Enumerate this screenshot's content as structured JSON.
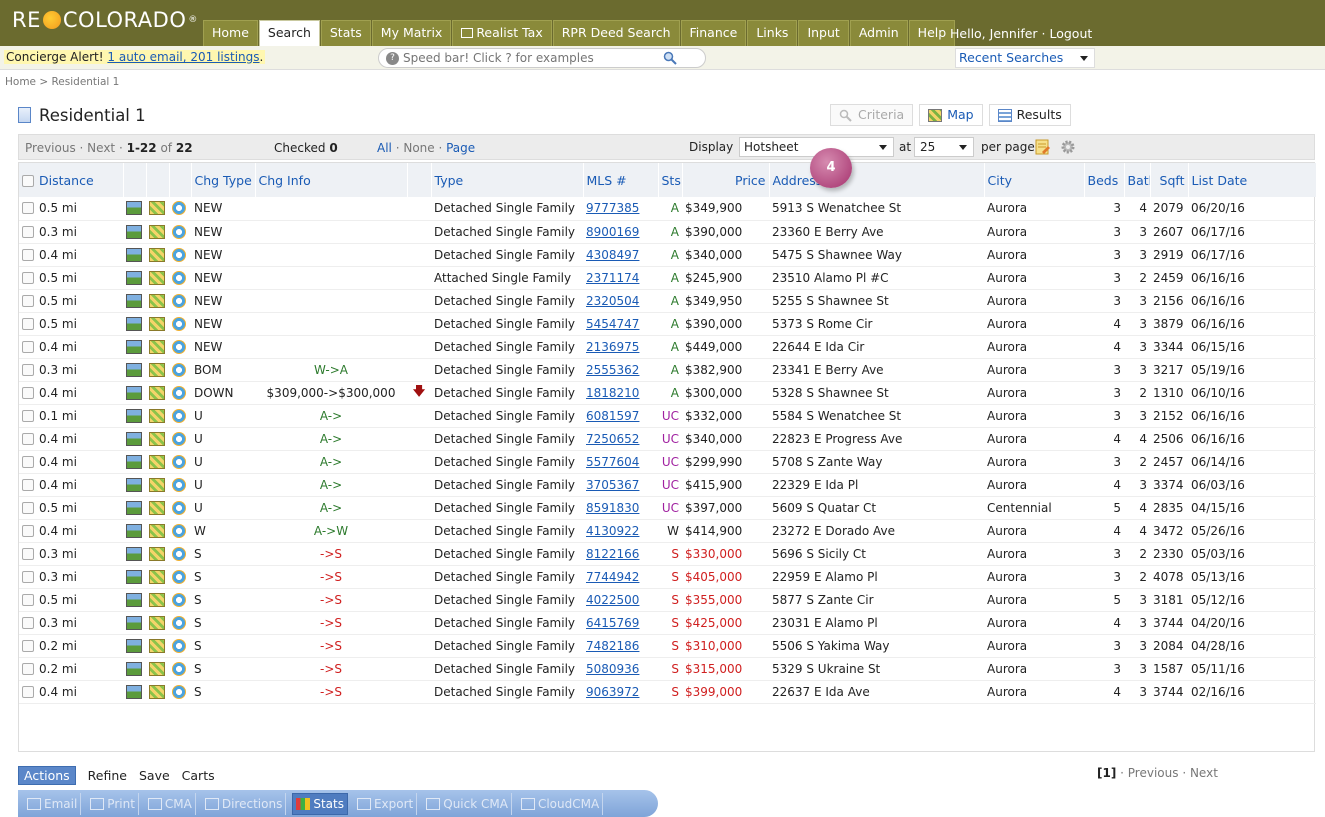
{
  "app": {
    "logo_text_left": "RE",
    "logo_text_right": "COLORADO",
    "logo_reg": "®",
    "greeting": "Hello, Jennifer · Logout"
  },
  "nav": {
    "tabs": [
      {
        "label": "Home",
        "active": false
      },
      {
        "label": "Search",
        "active": true
      },
      {
        "label": "Stats",
        "active": false
      },
      {
        "label": "My Matrix",
        "active": false
      },
      {
        "label": "Realist Tax",
        "active": false,
        "icon": "grid-icon"
      },
      {
        "label": "RPR Deed Search",
        "active": false
      },
      {
        "label": "Finance",
        "active": false
      },
      {
        "label": "Links",
        "active": false
      },
      {
        "label": "Input",
        "active": false
      },
      {
        "label": "Admin",
        "active": false
      },
      {
        "label": "Help",
        "active": false
      }
    ]
  },
  "alert": {
    "prefix": "Concierge Alert!",
    "link_text": "1 auto email, 201 listings",
    "suffix": "."
  },
  "speedbar": {
    "placeholder": "Speed bar! Click ? for examples",
    "help": "?"
  },
  "recent_searches": "Recent Searches",
  "breadcrumb": "Home > Residential 1",
  "page_title": "Residential 1",
  "view_tabs": {
    "criteria": "Criteria",
    "map": "Map",
    "results": "Results"
  },
  "toolbar": {
    "prev": "Previous",
    "next": "Next",
    "range": "1-22",
    "of": "of",
    "total": "22",
    "checked_label": "Checked",
    "checked_count": "0",
    "all": "All",
    "none": "None",
    "page": "Page",
    "display_label": "Display",
    "display_value": "Hotsheet",
    "at_label": "at",
    "per_page_value": "25",
    "per_page_label": "per page"
  },
  "step_badge": "4",
  "table": {
    "headers": {
      "distance": "Distance",
      "chg_type": "Chg Type",
      "chg_info": "Chg Info",
      "type": "Type",
      "mls": "MLS #",
      "sts": "Sts",
      "price": "Price",
      "address": "Address",
      "city": "City",
      "beds": "Beds",
      "baths": "Baths",
      "sqft": "Sqft",
      "list_date": "List Date"
    },
    "rows": [
      {
        "distance": "0.5 mi",
        "chg_type": "NEW",
        "chg_info": "",
        "arrow": "",
        "type": "Detached Single Family",
        "mls": "9777385",
        "sts": "A",
        "price": "$349,900",
        "address": "5913 S Wenatchee St",
        "city": "Aurora",
        "beds": "3",
        "baths": "4",
        "sqft": "2079",
        "list_date": "06/20/16"
      },
      {
        "distance": "0.3 mi",
        "chg_type": "NEW",
        "chg_info": "",
        "arrow": "",
        "type": "Detached Single Family",
        "mls": "8900169",
        "sts": "A",
        "price": "$390,000",
        "address": "23360 E Berry Ave",
        "city": "Aurora",
        "beds": "3",
        "baths": "3",
        "sqft": "2607",
        "list_date": "06/17/16"
      },
      {
        "distance": "0.4 mi",
        "chg_type": "NEW",
        "chg_info": "",
        "arrow": "",
        "type": "Detached Single Family",
        "mls": "4308497",
        "sts": "A",
        "price": "$340,000",
        "address": "5475 S Shawnee Way",
        "city": "Aurora",
        "beds": "3",
        "baths": "3",
        "sqft": "2919",
        "list_date": "06/17/16"
      },
      {
        "distance": "0.5 mi",
        "chg_type": "NEW",
        "chg_info": "",
        "arrow": "",
        "type": "Attached Single Family",
        "mls": "2371174",
        "sts": "A",
        "price": "$245,900",
        "address": "23510 Alamo Pl #C",
        "city": "Aurora",
        "beds": "3",
        "baths": "2",
        "sqft": "2459",
        "list_date": "06/16/16"
      },
      {
        "distance": "0.5 mi",
        "chg_type": "NEW",
        "chg_info": "",
        "arrow": "",
        "type": "Detached Single Family",
        "mls": "2320504",
        "sts": "A",
        "price": "$349,950",
        "address": "5255 S Shawnee St",
        "city": "Aurora",
        "beds": "3",
        "baths": "3",
        "sqft": "2156",
        "list_date": "06/16/16"
      },
      {
        "distance": "0.5 mi",
        "chg_type": "NEW",
        "chg_info": "",
        "arrow": "",
        "type": "Detached Single Family",
        "mls": "5454747",
        "sts": "A",
        "price": "$390,000",
        "address": "5373 S Rome Cir",
        "city": "Aurora",
        "beds": "4",
        "baths": "3",
        "sqft": "3879",
        "list_date": "06/16/16"
      },
      {
        "distance": "0.4 mi",
        "chg_type": "NEW",
        "chg_info": "",
        "arrow": "",
        "type": "Detached Single Family",
        "mls": "2136975",
        "sts": "A",
        "price": "$449,000",
        "address": "22644 E Ida Cir",
        "city": "Aurora",
        "beds": "4",
        "baths": "3",
        "sqft": "3344",
        "list_date": "06/15/16"
      },
      {
        "distance": "0.3 mi",
        "chg_type": "BOM",
        "chg_info": "W->A",
        "arrow": "",
        "type": "Detached Single Family",
        "mls": "2555362",
        "sts": "A",
        "price": "$382,900",
        "address": "23341 E Berry Ave",
        "city": "Aurora",
        "beds": "3",
        "baths": "3",
        "sqft": "3217",
        "list_date": "05/19/16"
      },
      {
        "distance": "0.4 mi",
        "chg_type": "DOWN",
        "chg_info": "$309,000->$300,000",
        "arrow": "🡇",
        "type": "Detached Single Family",
        "mls": "1818210",
        "sts": "A",
        "price": "$300,000",
        "address": "5328 S Shawnee St",
        "city": "Aurora",
        "beds": "3",
        "baths": "2",
        "sqft": "1310",
        "list_date": "06/10/16"
      },
      {
        "distance": "0.1 mi",
        "chg_type": "U",
        "chg_info": "A->",
        "arrow": "",
        "type": "Detached Single Family",
        "mls": "6081597",
        "sts": "UC",
        "price": "$332,000",
        "address": "5584 S Wenatchee St",
        "city": "Aurora",
        "beds": "3",
        "baths": "3",
        "sqft": "2152",
        "list_date": "06/16/16"
      },
      {
        "distance": "0.4 mi",
        "chg_type": "U",
        "chg_info": "A->",
        "arrow": "",
        "type": "Detached Single Family",
        "mls": "7250652",
        "sts": "UC",
        "price": "$340,000",
        "address": "22823 E Progress Ave",
        "city": "Aurora",
        "beds": "4",
        "baths": "4",
        "sqft": "2506",
        "list_date": "06/16/16"
      },
      {
        "distance": "0.4 mi",
        "chg_type": "U",
        "chg_info": "A->",
        "arrow": "",
        "type": "Detached Single Family",
        "mls": "5577604",
        "sts": "UC",
        "price": "$299,990",
        "address": "5708 S Zante Way",
        "city": "Aurora",
        "beds": "3",
        "baths": "2",
        "sqft": "2457",
        "list_date": "06/14/16"
      },
      {
        "distance": "0.4 mi",
        "chg_type": "U",
        "chg_info": "A->",
        "arrow": "",
        "type": "Detached Single Family",
        "mls": "3705367",
        "sts": "UC",
        "price": "$415,900",
        "address": "22329 E Ida Pl",
        "city": "Aurora",
        "beds": "4",
        "baths": "3",
        "sqft": "3374",
        "list_date": "06/03/16"
      },
      {
        "distance": "0.5 mi",
        "chg_type": "U",
        "chg_info": "A->",
        "arrow": "",
        "type": "Detached Single Family",
        "mls": "8591830",
        "sts": "UC",
        "price": "$397,000",
        "address": "5609 S Quatar Ct",
        "city": "Centennial",
        "beds": "5",
        "baths": "4",
        "sqft": "2835",
        "list_date": "04/15/16"
      },
      {
        "distance": "0.4 mi",
        "chg_type": "W",
        "chg_info": "A->W",
        "arrow": "",
        "type": "Detached Single Family",
        "mls": "4130922",
        "sts": "W",
        "price": "$414,900",
        "address": "23272 E Dorado Ave",
        "city": "Aurora",
        "beds": "4",
        "baths": "4",
        "sqft": "3472",
        "list_date": "05/26/16"
      },
      {
        "distance": "0.3 mi",
        "chg_type": "S",
        "chg_info": "->S",
        "arrow": "",
        "type": "Detached Single Family",
        "mls": "8122166",
        "sts": "S",
        "price": "$330,000",
        "address": "5696 S Sicily Ct",
        "city": "Aurora",
        "beds": "3",
        "baths": "2",
        "sqft": "2330",
        "list_date": "05/03/16"
      },
      {
        "distance": "0.3 mi",
        "chg_type": "S",
        "chg_info": "->S",
        "arrow": "",
        "type": "Detached Single Family",
        "mls": "7744942",
        "sts": "S",
        "price": "$405,000",
        "address": "22959 E Alamo Pl",
        "city": "Aurora",
        "beds": "3",
        "baths": "2",
        "sqft": "4078",
        "list_date": "05/13/16"
      },
      {
        "distance": "0.5 mi",
        "chg_type": "S",
        "chg_info": "->S",
        "arrow": "",
        "type": "Detached Single Family",
        "mls": "4022500",
        "sts": "S",
        "price": "$355,000",
        "address": "5877 S Zante Cir",
        "city": "Aurora",
        "beds": "5",
        "baths": "3",
        "sqft": "3181",
        "list_date": "05/12/16"
      },
      {
        "distance": "0.3 mi",
        "chg_type": "S",
        "chg_info": "->S",
        "arrow": "",
        "type": "Detached Single Family",
        "mls": "6415769",
        "sts": "S",
        "price": "$425,000",
        "address": "23031 E Alamo Pl",
        "city": "Aurora",
        "beds": "4",
        "baths": "3",
        "sqft": "3744",
        "list_date": "04/20/16"
      },
      {
        "distance": "0.2 mi",
        "chg_type": "S",
        "chg_info": "->S",
        "arrow": "",
        "type": "Detached Single Family",
        "mls": "7482186",
        "sts": "S",
        "price": "$310,000",
        "address": "5506 S Yakima Way",
        "city": "Aurora",
        "beds": "3",
        "baths": "3",
        "sqft": "2084",
        "list_date": "04/28/16"
      },
      {
        "distance": "0.2 mi",
        "chg_type": "S",
        "chg_info": "->S",
        "arrow": "",
        "type": "Detached Single Family",
        "mls": "5080936",
        "sts": "S",
        "price": "$315,000",
        "address": "5329 S Ukraine St",
        "city": "Aurora",
        "beds": "3",
        "baths": "3",
        "sqft": "1587",
        "list_date": "05/11/16"
      },
      {
        "distance": "0.4 mi",
        "chg_type": "S",
        "chg_info": "->S",
        "arrow": "",
        "type": "Detached Single Family",
        "mls": "9063972",
        "sts": "S",
        "price": "$399,000",
        "address": "22637 E Ida Ave",
        "city": "Aurora",
        "beds": "4",
        "baths": "3",
        "sqft": "3744",
        "list_date": "02/16/16"
      }
    ]
  },
  "bottom_paging": {
    "current": "[1]",
    "prev": "Previous",
    "next": "Next"
  },
  "actions_tabs": [
    "Actions",
    "Refine",
    "Save",
    "Carts"
  ],
  "action_buttons": [
    {
      "label": "Email",
      "icon": "email-icon",
      "on": false
    },
    {
      "label": "Print",
      "icon": "print-icon",
      "on": false
    },
    {
      "label": "CMA",
      "icon": "cma-icon",
      "on": false
    },
    {
      "label": "Directions",
      "icon": "directions-icon",
      "on": false
    },
    {
      "label": "Stats",
      "icon": "stats-icon",
      "on": true
    },
    {
      "label": "Export",
      "icon": "export-icon",
      "on": false
    },
    {
      "label": "Quick CMA",
      "icon": "quick-cma-icon",
      "on": false
    },
    {
      "label": "CloudCMA",
      "icon": "cloud-cma-icon",
      "on": false
    }
  ],
  "colors": {
    "topbar": "#6b6b2f",
    "link": "#1a5bb5",
    "status_active": "#2c7a2c",
    "status_uc": "#a020a0",
    "status_sold": "#d02020",
    "step_badge": "#a4306c"
  }
}
